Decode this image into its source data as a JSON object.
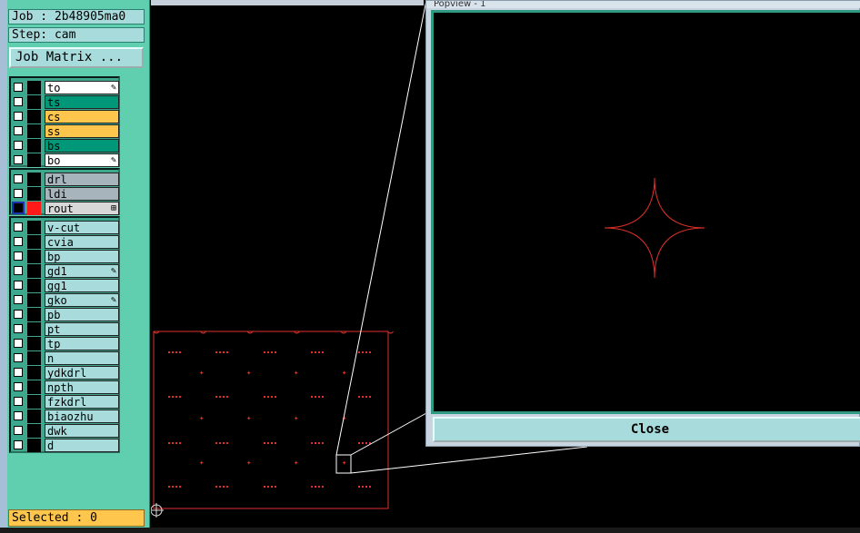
{
  "job": {
    "label": "Job : 2b48905ma0"
  },
  "step": {
    "label": "Step: cam"
  },
  "job_matrix_button": "Job Matrix ...",
  "layer_groups": [
    [
      {
        "name": "to",
        "color": "#ffffff",
        "mark": true,
        "sq": "#000000"
      },
      {
        "name": "ts",
        "color": "#009878",
        "mark": false,
        "sq": "#000000"
      },
      {
        "name": "cs",
        "color": "#ffc64e",
        "mark": false,
        "sq": "#000000"
      },
      {
        "name": "ss",
        "color": "#ffc64e",
        "mark": false,
        "sq": "#000000"
      },
      {
        "name": "bs",
        "color": "#009878",
        "mark": false,
        "sq": "#000000"
      },
      {
        "name": "bo",
        "color": "#ffffff",
        "mark": true,
        "sq": "#000000"
      }
    ],
    [
      {
        "name": "drl",
        "color": "#a8b4bc",
        "mark": false,
        "sq": "#000000"
      },
      {
        "name": "ldi",
        "color": "#a8b4bc",
        "mark": false,
        "sq": "#000000"
      },
      {
        "name": "rout",
        "color": "#d8d8d8",
        "mark": "⊞",
        "sq": "#ff1a1a",
        "active": true
      }
    ],
    [
      {
        "name": "v-cut",
        "color": "#a8dcdc"
      },
      {
        "name": "cvia",
        "color": "#a8dcdc"
      },
      {
        "name": "bp",
        "color": "#a8dcdc"
      },
      {
        "name": "gd1",
        "color": "#a8dcdc",
        "mark": true
      },
      {
        "name": "gg1",
        "color": "#a8dcdc"
      },
      {
        "name": "gko",
        "color": "#a8dcdc",
        "mark": true
      },
      {
        "name": "pb",
        "color": "#a8dcdc"
      },
      {
        "name": "pt",
        "color": "#a8dcdc"
      },
      {
        "name": "tp",
        "color": "#a8dcdc"
      },
      {
        "name": "n",
        "color": "#a8dcdc"
      },
      {
        "name": "ydkdrl",
        "color": "#a8dcdc"
      },
      {
        "name": "npth",
        "color": "#a8dcdc"
      },
      {
        "name": "fzkdrl",
        "color": "#a8dcdc"
      },
      {
        "name": "biaozhu",
        "color": "#a8dcdc"
      },
      {
        "name": "dwk",
        "color": "#a8dcdc"
      },
      {
        "name": "d",
        "color": "#a8dcdc"
      }
    ]
  ],
  "selected": {
    "label": "Selected : 0"
  },
  "popup": {
    "title": "Popview - 1",
    "close_label": "Close"
  },
  "colors": {
    "board": "#e0302a",
    "zoom_lines": "#ffffff"
  }
}
